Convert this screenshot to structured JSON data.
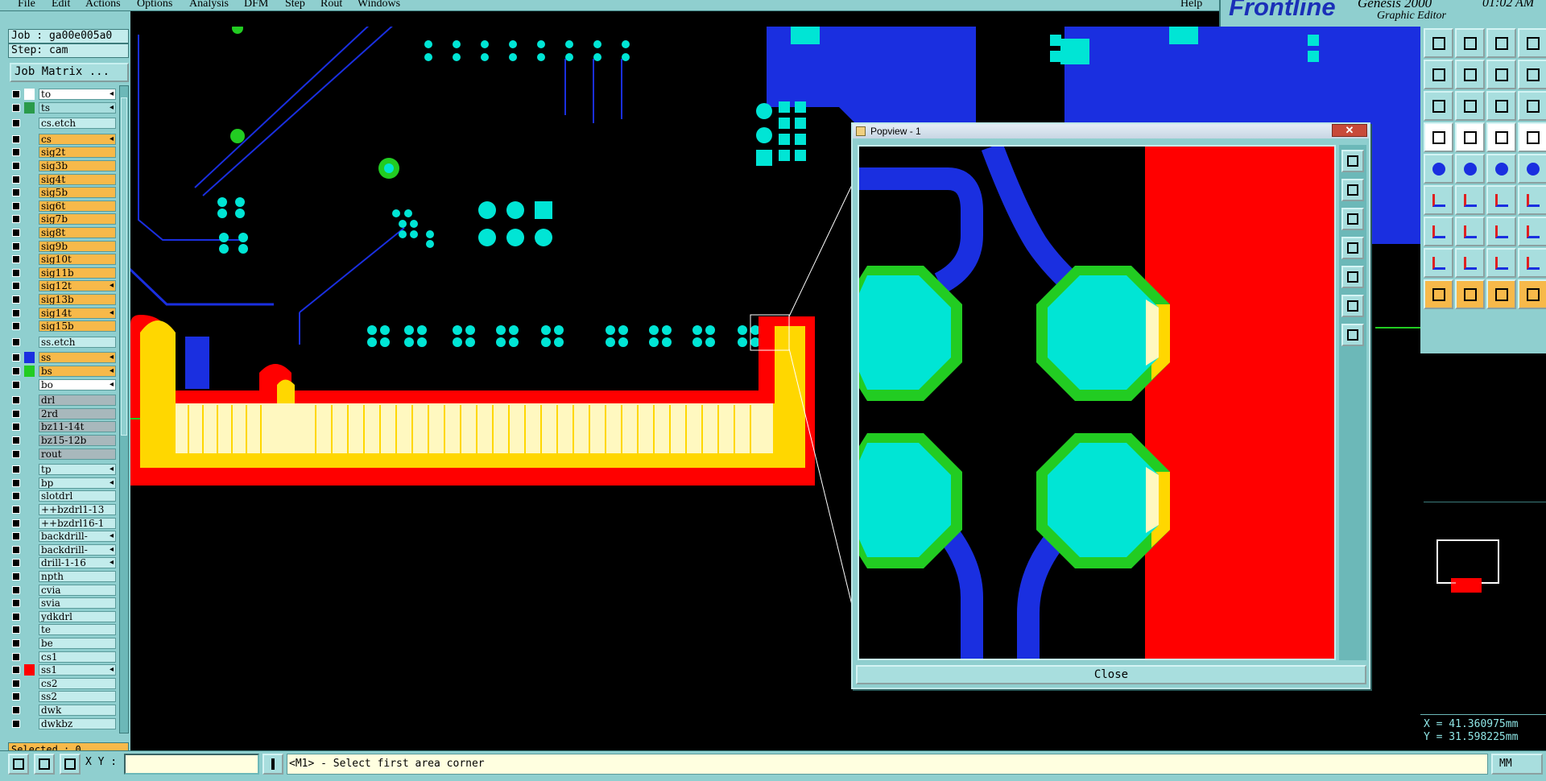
{
  "menu": {
    "items": [
      "File",
      "Edit",
      "Actions",
      "Options",
      "Analysis",
      "DFM",
      "Step",
      "Rout",
      "Windows"
    ],
    "help": "Help"
  },
  "brand": {
    "logo": "Frontline",
    "product": "Genesis 2000",
    "subtitle": "Graphic Editor",
    "time": "01:02 AM"
  },
  "job": {
    "job_line": "Job : ga00e005a0",
    "step_line": "Step: cam",
    "matrix_button": "Job Matrix ..."
  },
  "layers": [
    {
      "name": "to",
      "color": "#ffffff",
      "bg": "white",
      "arrow": true
    },
    {
      "name": "ts",
      "color": "#2a9a4a",
      "bg": "cyanbg",
      "arrow": true
    },
    {
      "name": "cs.etch",
      "color": "",
      "bg": "plain",
      "arrow": false
    },
    {
      "name": "cs",
      "color": "",
      "bg": "orange",
      "arrow": true
    },
    {
      "name": "sig2t",
      "color": "",
      "bg": "orange",
      "arrow": false
    },
    {
      "name": "sig3b",
      "color": "",
      "bg": "orange",
      "arrow": false
    },
    {
      "name": "sig4t",
      "color": "",
      "bg": "orange",
      "arrow": false
    },
    {
      "name": "sig5b",
      "color": "",
      "bg": "orange",
      "arrow": false
    },
    {
      "name": "sig6t",
      "color": "",
      "bg": "orange",
      "arrow": false
    },
    {
      "name": "sig7b",
      "color": "",
      "bg": "orange",
      "arrow": false
    },
    {
      "name": "sig8t",
      "color": "",
      "bg": "orange",
      "arrow": false
    },
    {
      "name": "sig9b",
      "color": "",
      "bg": "orange",
      "arrow": false
    },
    {
      "name": "sig10t",
      "color": "",
      "bg": "orange",
      "arrow": false
    },
    {
      "name": "sig11b",
      "color": "",
      "bg": "orange",
      "arrow": false
    },
    {
      "name": "sig12t",
      "color": "",
      "bg": "orange",
      "arrow": true
    },
    {
      "name": "sig13b",
      "color": "",
      "bg": "orange",
      "arrow": false
    },
    {
      "name": "sig14t",
      "color": "",
      "bg": "orange",
      "arrow": true
    },
    {
      "name": "sig15b",
      "color": "",
      "bg": "orange",
      "arrow": false
    },
    {
      "name": "ss.etch",
      "color": "",
      "bg": "plain",
      "arrow": false
    },
    {
      "name": "ss",
      "color": "#1a2fe0",
      "bg": "orange",
      "arrow": true
    },
    {
      "name": "bs",
      "color": "#22cc22",
      "bg": "orange",
      "arrow": true
    },
    {
      "name": "bo",
      "color": "",
      "bg": "white",
      "arrow": true
    },
    {
      "name": "drl",
      "color": "",
      "bg": "grey",
      "arrow": false
    },
    {
      "name": "2rd",
      "color": "",
      "bg": "grey",
      "arrow": false
    },
    {
      "name": "bz11-14t",
      "color": "",
      "bg": "grey",
      "arrow": false
    },
    {
      "name": "bz15-12b",
      "color": "",
      "bg": "grey",
      "arrow": false
    },
    {
      "name": "rout",
      "color": "",
      "bg": "grey",
      "arrow": false
    },
    {
      "name": "tp",
      "color": "",
      "bg": "plain",
      "arrow": true
    },
    {
      "name": "bp",
      "color": "",
      "bg": "plain",
      "arrow": true
    },
    {
      "name": "slotdrl",
      "color": "",
      "bg": "plain",
      "arrow": false
    },
    {
      "name": "++bzdrl1-13",
      "color": "",
      "bg": "plain",
      "arrow": false
    },
    {
      "name": "++bzdrl16-1",
      "color": "",
      "bg": "plain",
      "arrow": false
    },
    {
      "name": "backdrill-",
      "color": "",
      "bg": "plain",
      "arrow": true
    },
    {
      "name": "backdrill-",
      "color": "",
      "bg": "plain",
      "arrow": true
    },
    {
      "name": "drill-1-16",
      "color": "",
      "bg": "plain",
      "arrow": true
    },
    {
      "name": "npth",
      "color": "",
      "bg": "plain",
      "arrow": false
    },
    {
      "name": "cvia",
      "color": "",
      "bg": "plain",
      "arrow": false
    },
    {
      "name": "svia",
      "color": "",
      "bg": "plain",
      "arrow": false
    },
    {
      "name": "ydkdrl",
      "color": "",
      "bg": "plain",
      "arrow": false
    },
    {
      "name": "te",
      "color": "",
      "bg": "plain",
      "arrow": false
    },
    {
      "name": "be",
      "color": "",
      "bg": "plain",
      "arrow": false
    },
    {
      "name": "cs1",
      "color": "",
      "bg": "plain",
      "arrow": false
    },
    {
      "name": "ss1",
      "color": "#ff0000",
      "bg": "plain",
      "arrow": true
    },
    {
      "name": "cs2",
      "color": "",
      "bg": "plain",
      "arrow": false
    },
    {
      "name": "ss2",
      "color": "",
      "bg": "plain",
      "arrow": false
    },
    {
      "name": "dwk",
      "color": "",
      "bg": "plain",
      "arrow": false
    },
    {
      "name": "dwkbz",
      "color": "",
      "bg": "plain",
      "arrow": false
    }
  ],
  "selected": "Selected : 0",
  "popview": {
    "title": "Popview - 1",
    "close_label": "Close"
  },
  "coords": {
    "x": "X = 41.360975mm",
    "y": "Y = 31.598225mm"
  },
  "status": {
    "xy_label": "X Y :",
    "message": "<M1> - Select first area corner",
    "units": "MM"
  },
  "colors": {
    "panel": "#8fcfcf",
    "copper_red": "#ff0000",
    "gold_yellow": "#ffd700",
    "trace_blue": "#1a2fe0",
    "pad_cyan": "#00e5d5",
    "mask_green": "#22cc22"
  }
}
